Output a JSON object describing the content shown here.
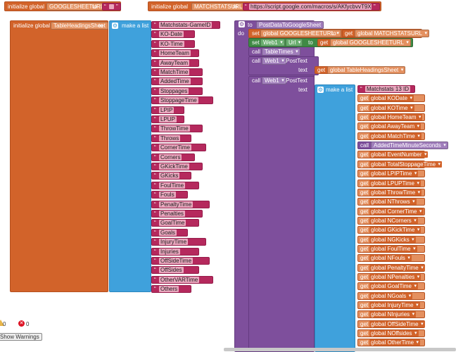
{
  "globals": {
    "init_label": "initialize global",
    "to_label": "to",
    "sheet_url_name": "GOOGLESHEETURL",
    "match_url_name": "MATCHSTATSURL",
    "match_url_value": "https://script.google.com/macros/s/AKfycbvvT9X2Z..."
  },
  "headings_block": {
    "init_label": "initialize global",
    "name": "TableHeadingsSheet",
    "to_label": "to",
    "make_list_label": "make a list",
    "items": [
      "Matchstats-GameID",
      "KO-Date",
      "KO-Time",
      "HomeTeam",
      "AwayTeam",
      "MatchTime",
      "AddedTime",
      "Stoppages",
      "StoppageTime",
      "LPIP",
      "LPUP",
      "ThrowTime",
      "Throws",
      "CornerTime",
      "Corners",
      "GKickTime",
      "GKicks",
      "FoulTime",
      "Fouls",
      "PenaltyTime",
      "Penalties",
      "GoalTime",
      "Goals",
      "InjuryTime",
      "Injuries",
      "OffSideTime",
      "OffSides",
      "OtherVARTime",
      "Others"
    ]
  },
  "procedure": {
    "to_label": "to",
    "name": "PostDataToGoogleSheet",
    "do_label": "do",
    "set_label": "set",
    "get_label": "get",
    "to_kw": "to",
    "call_label": "call",
    "set_global_name": "global GOOGLESHEETURL",
    "get_match_url": "global MATCHSTATSURL",
    "web_component": "Web1",
    "url_prop": "Url",
    "get_sheet_url": "global GOOGLESHEETURL",
    "table_times": "TableTimes",
    "post_text": ".PostText",
    "text_label": "text",
    "get_headings": "global TableHeadingsSheet",
    "make_list_label": "make a list",
    "first_item": "Matchstats 13 ID",
    "call_added": "AddedTimeMinuteSeconds",
    "gets_before": [
      "global KODate",
      "global KOTime",
      "global HomeTeam",
      "global AwayTeam",
      "global MatchTime"
    ],
    "gets_after": [
      "global EventNumber",
      "global TotalStoppageTime",
      "global LPIPTime",
      "global LPUPTime",
      "global ThrowTime",
      "global NThrows",
      "global CornerTime",
      "global NCorners",
      "global GKickTime",
      "global NGKicks",
      "global FoulTime",
      "global NFouls",
      "global PenaltyTime",
      "global NPenalties",
      "global GoalTime",
      "global NGoals",
      "global InjuryTime",
      "global NInjuries",
      "global OffSideTime",
      "global NOffsides",
      "global OtherTime"
    ]
  },
  "warnings": {
    "warn_count": "0",
    "error_count": "0",
    "show_label": "Show Warnings"
  },
  "colors": {
    "variables": "#d2632a",
    "lists": "#3fa1dc",
    "text": "#b5295d",
    "procedures": "#7e4f9c",
    "components": "#3f8a45"
  }
}
